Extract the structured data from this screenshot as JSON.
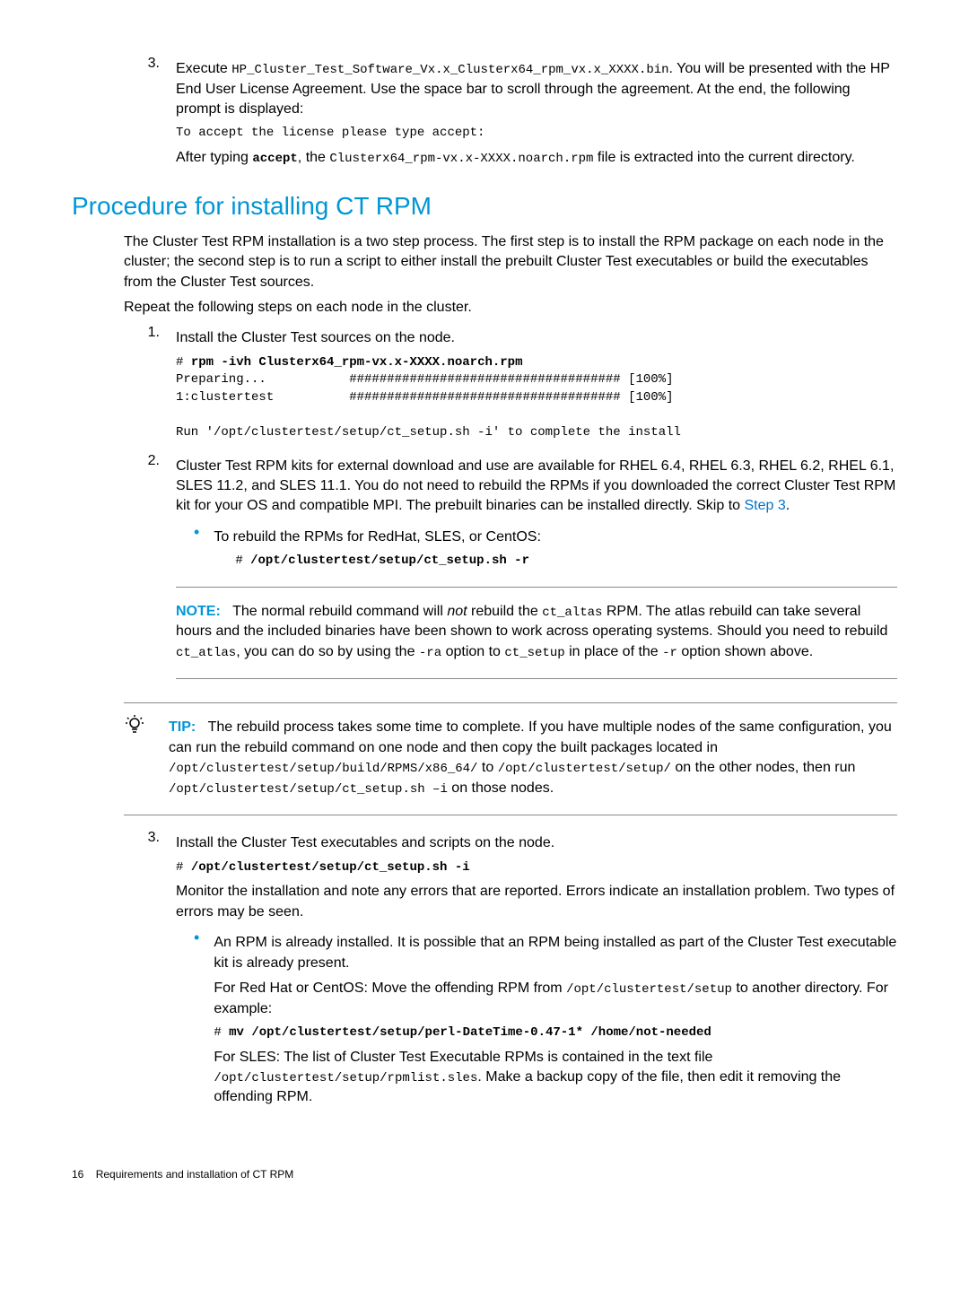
{
  "step3_top": {
    "num": "3.",
    "line1_a": "Execute ",
    "line1_code": "HP_Cluster_Test_Software_Vx.x_Clusterx64_rpm_vx.x_XXXX.bin",
    "line1_b": ". You will be presented with the HP End User License Agreement. Use the space bar to scroll through the agreement. At the end, the following prompt is displayed:",
    "prompt": "To accept the license please type accept:",
    "after_a": "After typing ",
    "after_accept": "accept",
    "after_b": ", the ",
    "after_code": "Clusterx64_rpm-vx.x-XXXX.noarch.rpm",
    "after_c": " file is extracted into the current directory."
  },
  "section_title": "Procedure for installing CT RPM",
  "intro_p1": "The Cluster Test RPM installation is a two step process. The first step is to install the RPM package on each node in the cluster; the second step is to run a script to either install the prebuilt Cluster Test executables or build the executables from the Cluster Test sources.",
  "intro_p2": "Repeat the following steps on each node in the cluster.",
  "ct_step1": {
    "num": "1.",
    "text": "Install the Cluster Test sources on the node.",
    "code_block": "# rpm -ivh Clusterx64_rpm-vx.x-XXXX.noarch.rpm\nPreparing...           #################################### [100%]\n1:clustertest          #################################### [100%]\n\nRun '/opt/clustertest/setup/ct_setup.sh -i' to complete the install",
    "code_bold": "rpm -ivh Clusterx64_rpm-vx.x-XXXX.noarch.rpm"
  },
  "ct_step2": {
    "num": "2.",
    "text_a": "Cluster Test RPM kits for external download and use are available for RHEL 6.4, RHEL 6.3, RHEL 6.2, RHEL 6.1, SLES 11.2, and SLES 11.1. You do not need to rebuild the RPMs if you downloaded the correct Cluster Test RPM kit for your OS and compatible MPI. The prebuilt binaries can be installed directly. Skip to ",
    "link": "Step 3",
    "text_b": ".",
    "bullet_text": "To rebuild the RPMs for RedHat, SLES, or CentOS:",
    "bullet_code_prefix": "# ",
    "bullet_code": "/opt/clustertest/setup/ct_setup.sh -r"
  },
  "note": {
    "label": "NOTE:",
    "t1": "The normal rebuild command will ",
    "not": "not",
    "t2": " rebuild the ",
    "code1": "ct_altas",
    "t3": " RPM. The atlas rebuild can take several hours and the included binaries have been shown to work across operating systems. Should you need to rebuild ",
    "code2": "ct_atlas",
    "t4": ", you can do so by using the ",
    "code3": " -ra",
    "t5": " option to ",
    "code4": "ct_setup",
    "t6": " in place of the ",
    "code5": "-r",
    "t7": " option shown above."
  },
  "tip": {
    "label": "TIP:",
    "t1": "The rebuild process takes some time to complete. If you have multiple nodes of the same configuration, you can run the rebuild command on one node and then copy the built packages located in ",
    "code1": "/opt/clustertest/setup/build/RPMS/x86_64/",
    "t2": " to ",
    "code2": "/opt/clustertest/setup/",
    "t3": " on the other nodes, then run ",
    "code3": "/opt/clustertest/setup/ct_setup.sh –i",
    "t4": " on those nodes."
  },
  "ct_step3": {
    "num": "3.",
    "text": "Install the Cluster Test executables and scripts on the node.",
    "code_prefix": "# ",
    "code": "/opt/clustertest/setup/ct_setup.sh -i",
    "p2": "Monitor the installation and note any errors that are reported. Errors indicate an installation problem. Two types of errors may be seen.",
    "bullet_text": "An RPM is already installed. It is possible that an RPM being installed as part of the Cluster Test executable kit is already present.",
    "rh_a": "For Red Hat or CentOS: Move the offending RPM from ",
    "rh_code": "/opt/clustertest/setup",
    "rh_b": " to another directory. For example:",
    "mv_prefix": "# ",
    "mv_code": "mv /opt/clustertest/setup/perl-DateTime-0.47-1* /home/not-needed",
    "sles_a": "For SLES: The list of Cluster Test Executable RPMs is contained in the text file ",
    "sles_code": "/opt/clustertest/setup/rpmlist.sles",
    "sles_b": ". Make a backup copy of the file, then edit it removing the offending RPM."
  },
  "footer": {
    "page": "16",
    "title": "Requirements and installation of CT RPM"
  }
}
